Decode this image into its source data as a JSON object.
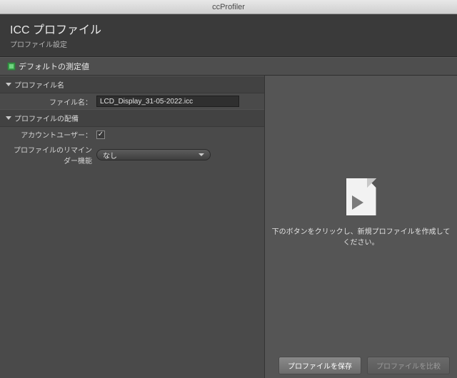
{
  "titlebar": "ccProfiler",
  "header": {
    "title": "ICC プロファイル",
    "subtitle": "プロファイル設定"
  },
  "section": {
    "title": "デフォルトの測定値"
  },
  "group_profile_name": {
    "label": "プロファイル名",
    "filename_label": "ファイル名：",
    "filename_value": "LCD_Display_31-05-2022.icc"
  },
  "group_distribution": {
    "label": "プロファイルの配備",
    "account_user_label": "アカウントユーザー：",
    "account_user_checked": "✓",
    "reminder_label": "プロファイルのリマインダー機能",
    "reminder_value": "なし"
  },
  "preview": {
    "instruction": "下のボタンをクリックし、新規プロファイルを作成してください。"
  },
  "footer": {
    "save_label": "プロファイルを保存",
    "compare_label": "プロファイルを比較"
  }
}
